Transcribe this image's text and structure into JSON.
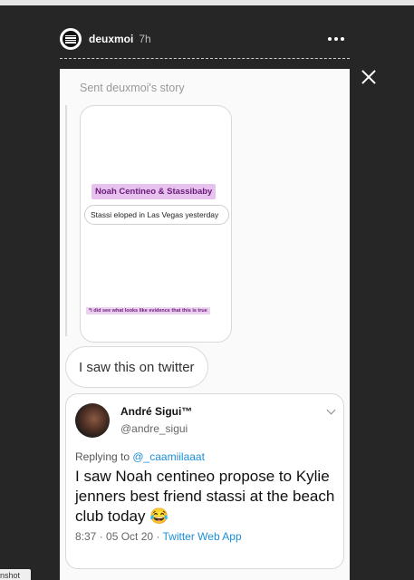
{
  "header": {
    "username": "deuxmoi",
    "time": "7h"
  },
  "story": {
    "sent_label": "Sent deuxmoi's story",
    "thumb": {
      "title": "Noah Centineo & Stassibaby",
      "bubble": "Stassi eloped in Las Vegas yesterday",
      "note": "*i did see what looks like evidence that this is true"
    },
    "reply_text": "I saw this on twitter",
    "tweet": {
      "name": "André Sigui™",
      "handle": "@andre_sigui",
      "replying_prefix": "Replying to ",
      "replying_to": "@_caamiilaaat",
      "body": "I saw Noah centineo propose to Kylie jenners best friend stassi at the beach club today 😂",
      "timestamp": "8:37 · 05 Oct 20 · ",
      "app": "Twitter Web App"
    }
  },
  "tooltip": "nshot"
}
